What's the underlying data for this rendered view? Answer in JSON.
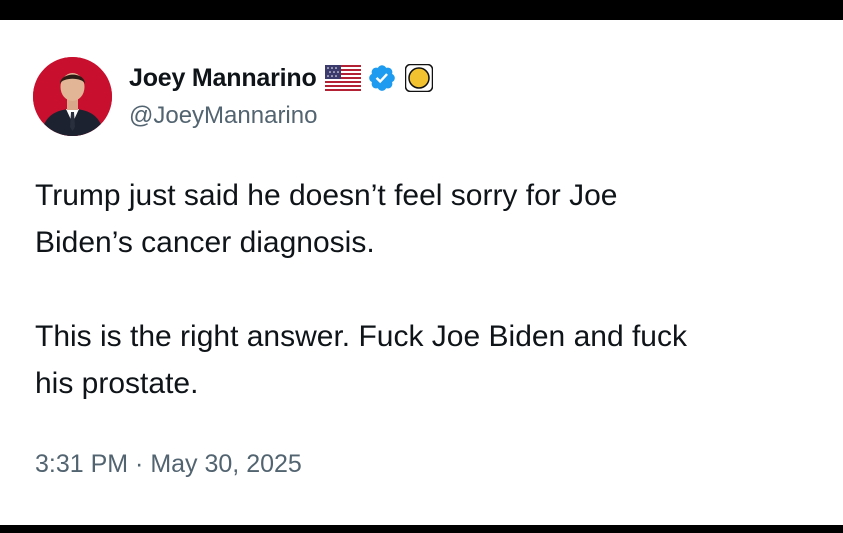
{
  "tweet": {
    "author": {
      "display_name": "Joey Mannarino",
      "handle": "@JoeyMannarino",
      "badges": [
        "us-flag-icon",
        "verified-icon",
        "gold-circle-icon"
      ]
    },
    "paragraphs": [
      "Trump just said he doesn’t feel sorry for Joe\nBiden’s cancer diagnosis.",
      "This is the right answer. Fuck Joe Biden and fuck\nhis prostate."
    ],
    "timestamp": "3:31 PM · May 30, 2025"
  },
  "colors": {
    "text_primary": "#0f1419",
    "text_secondary": "#536471",
    "verified_blue": "#1d9bf0",
    "avatar_background": "#c8102e",
    "letterbox": "#000000"
  }
}
